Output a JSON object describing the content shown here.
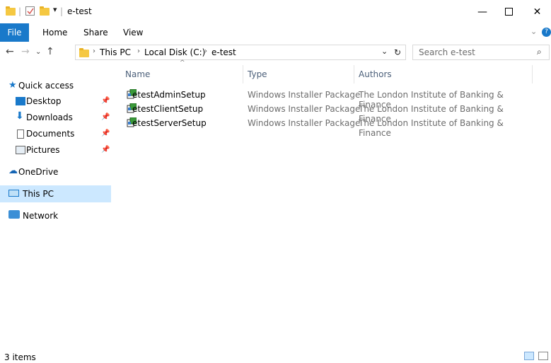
{
  "window": {
    "title": "e-test"
  },
  "ribbon": {
    "tabs": [
      "File",
      "Home",
      "Share",
      "View"
    ]
  },
  "address": {
    "crumbs": [
      "This PC",
      "Local Disk (C:)",
      "e-test"
    ],
    "search_placeholder": "Search e-test"
  },
  "nav": {
    "quick_access": "Quick access",
    "items": [
      {
        "label": "Desktop",
        "pinned": true
      },
      {
        "label": "Downloads",
        "pinned": true
      },
      {
        "label": "Documents",
        "pinned": true
      },
      {
        "label": "Pictures",
        "pinned": true
      }
    ],
    "onedrive": "OneDrive",
    "thispc": "This PC",
    "network": "Network"
  },
  "columns": [
    "Name",
    "Type",
    "Authors"
  ],
  "files": [
    {
      "name": "etestAdminSetup",
      "type": "Windows Installer Package",
      "authors": "The London Institute of Banking & Finance"
    },
    {
      "name": "etestClientSetup",
      "type": "Windows Installer Package",
      "authors": "The London Institute of Banking & Finance"
    },
    {
      "name": "etestServerSetup",
      "type": "Windows Installer Package",
      "authors": "The London Institute of Banking & Finance"
    }
  ],
  "status": {
    "count": "3 items"
  },
  "colors": {
    "accent": "#1979ca",
    "selection": "#cce8ff",
    "folder": "#f5c842"
  }
}
